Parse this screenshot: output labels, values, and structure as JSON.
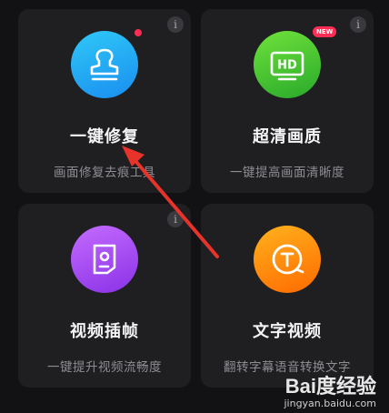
{
  "cards": [
    {
      "title": "一键修复",
      "desc": "画面修复去痕工具",
      "icon": "stamp-icon",
      "info": "i",
      "badge_dot": true
    },
    {
      "title": "超清画质",
      "desc": "一键提高画面清晰度",
      "icon": "hd-icon",
      "info": "i",
      "badge_text": "NEW"
    },
    {
      "title": "视频插帧",
      "desc": "一键提升视频流畅度",
      "icon": "frame-interpolation-icon",
      "info": "i"
    },
    {
      "title": "文字视频",
      "desc": "翻转字幕语音转换文字",
      "icon": "text-t-icon"
    }
  ],
  "colors": {
    "background": "#121214",
    "card": "#1f1f22",
    "arrow": "#e8332a",
    "badge": "#ff2d55"
  },
  "watermark": {
    "logo": "Bai度经验",
    "url": "jingyan.baidu.com"
  }
}
